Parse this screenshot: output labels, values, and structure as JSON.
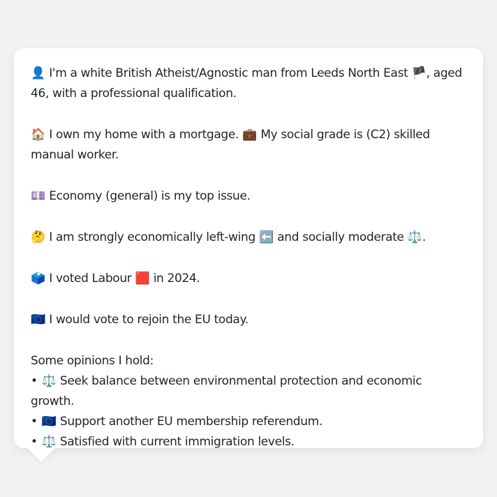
{
  "profile": {
    "identity": {
      "icon": "👤",
      "text_a": "I'm a white British Atheist/Agnostic man from Leeds North East",
      "flag": "🏴",
      "text_b": ", aged 46, with a professional qualification."
    },
    "housing": {
      "icon": "🏠",
      "text_a": "I own my home with a mortgage.",
      "icon2": "💼",
      "text_b": "My social grade is (C2) skilled manual worker."
    },
    "issue": {
      "icon": "💷",
      "text": "Economy (general) is my top issue."
    },
    "ideology": {
      "icon": "🤔",
      "text_a": "I am strongly economically left-wing",
      "icon2": "⬅️",
      "text_b": "and socially moderate",
      "icon3": "⚖️",
      "text_c": "."
    },
    "vote": {
      "icon": "🗳️",
      "text_a": "I voted Labour",
      "icon2": "🟥",
      "text_b": "in 2024."
    },
    "eu": {
      "icon": "🇪🇺",
      "text": "I would vote to rejoin the EU today."
    },
    "opinions": {
      "heading": "Some opinions I hold:",
      "bullet": "•",
      "items": [
        {
          "icon": "⚖️",
          "text": "Seek balance between environmental protection and economic growth."
        },
        {
          "icon": "🇪🇺",
          "text": "Support another EU membership referendum."
        },
        {
          "icon": "⚖️",
          "text": "Satisfied with current immigration levels."
        }
      ]
    }
  },
  "colors": {
    "page_background": "#f1f2f4",
    "card_background": "#ffffff",
    "text": "#1f2328"
  }
}
